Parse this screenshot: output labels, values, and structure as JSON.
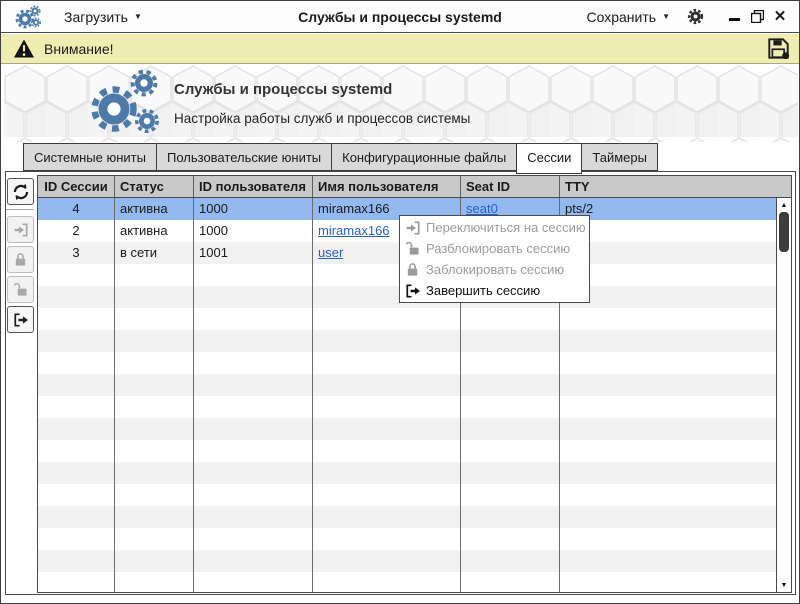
{
  "titlebar": {
    "app_icon": "gears-icon",
    "load_label": "Загрузить",
    "title": "Службы и процессы systemd",
    "save_label": "Сохранить",
    "settings_icon": "gear-icon",
    "window_controls": [
      "minimize",
      "maximize",
      "close"
    ]
  },
  "warning_bar": {
    "label": "Внимание!",
    "icons": [
      "warning-icon",
      "floppy-save-icon"
    ]
  },
  "banner": {
    "title": "Службы и процессы systemd",
    "subtitle": "Настройка работы служб и процессов системы",
    "logo_icon": "gears-icon"
  },
  "tabs": [
    {
      "id": "system-units",
      "label": "Системные юниты",
      "active": false
    },
    {
      "id": "user-units",
      "label": "Пользовательские юниты",
      "active": false
    },
    {
      "id": "config-files",
      "label": "Конфигурационные файлы",
      "active": false
    },
    {
      "id": "sessions",
      "label": "Сессии",
      "active": true
    },
    {
      "id": "timers",
      "label": "Таймеры",
      "active": false
    }
  ],
  "toolbar": [
    {
      "id": "refresh",
      "icon": "refresh-icon",
      "enabled": true
    },
    {
      "id": "switch-session",
      "icon": "enter-session-icon",
      "enabled": false
    },
    {
      "id": "lock-session",
      "icon": "lock-icon",
      "enabled": false
    },
    {
      "id": "unlock-session",
      "icon": "unlock-icon",
      "enabled": false
    },
    {
      "id": "terminate-session",
      "icon": "logout-icon",
      "enabled": true
    }
  ],
  "table": {
    "columns": [
      "ID Сессии",
      "Статус",
      "ID пользователя",
      "Имя пользователя",
      "Seat ID",
      "TTY"
    ],
    "rows": [
      {
        "cells": [
          "4",
          "активна",
          "1000",
          "miramax166",
          "seat0",
          "pts/2"
        ],
        "link_cols": [
          4
        ],
        "selected": true
      },
      {
        "cells": [
          "2",
          "активна",
          "1000",
          "miramax166",
          "",
          ""
        ],
        "link_cols": [
          3
        ],
        "selected": false
      },
      {
        "cells": [
          "3",
          "в сети",
          "1001",
          "user",
          "",
          ""
        ],
        "link_cols": [
          3
        ],
        "selected": false
      }
    ],
    "empty_row_count": 15
  },
  "context_menu": {
    "items": [
      {
        "id": "switch-to-session",
        "icon": "enter-session-icon",
        "label": "Переключиться на сессию",
        "enabled": false
      },
      {
        "id": "unlock-session",
        "icon": "unlock-icon",
        "label": "Разблокировать сессию",
        "enabled": false
      },
      {
        "id": "lock-session",
        "icon": "lock-icon",
        "label": "Заблокировать сессию",
        "enabled": false
      },
      {
        "id": "terminate-session",
        "icon": "logout-icon",
        "label": "Завершить сессию",
        "enabled": true
      }
    ]
  },
  "colors": {
    "selection": "#94b9f0",
    "gears_blue": "#4d7aa8",
    "warning_bg": "#f0edb2",
    "link": "#2462c8",
    "header_bg": "#c9c9c9",
    "alt_row": "#f1f1f1"
  }
}
